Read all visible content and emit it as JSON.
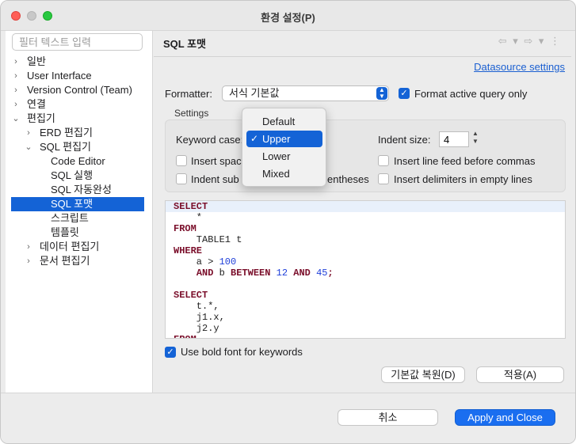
{
  "window": {
    "title": "환경 설정(P)"
  },
  "sidebar": {
    "filter_placeholder": "필터 텍스트 입력",
    "items": [
      {
        "label": "일반",
        "chevron": "›"
      },
      {
        "label": "User Interface",
        "chevron": "›"
      },
      {
        "label": "Version Control (Team)",
        "chevron": "›"
      },
      {
        "label": "연결",
        "chevron": "›"
      },
      {
        "label": "편집기",
        "chevron": "⌄"
      },
      {
        "label": "ERD 편집기",
        "chevron": "›"
      },
      {
        "label": "SQL 편집기",
        "chevron": "⌄"
      },
      {
        "label": "Code Editor",
        "chevron": ""
      },
      {
        "label": "SQL 실행",
        "chevron": ""
      },
      {
        "label": "SQL 자동완성",
        "chevron": ""
      },
      {
        "label": "SQL 포맷",
        "chevron": "",
        "selected": true
      },
      {
        "label": "스크립트",
        "chevron": ""
      },
      {
        "label": "템플릿",
        "chevron": ""
      },
      {
        "label": "데이터 편집기",
        "chevron": "›"
      },
      {
        "label": "문서 편집기",
        "chevron": "›"
      }
    ]
  },
  "main": {
    "title": "SQL 포맷",
    "nav_arrows": "⇦ ▾  ⇨ ▾   ⋮",
    "datasource_link": "Datasource settings",
    "formatter_label": "Formatter:",
    "formatter_value": "서식 기본값",
    "format_active_query_label": "Format active query only",
    "format_active_query_checked": true,
    "settings_legend": "Settings",
    "keyword_case_label": "Keyword case:",
    "indent_size_label": "Indent size:",
    "indent_size_value": "4",
    "insert_spaces_label": "Insert spac",
    "indent_sub_label": "Indent sub",
    "parentheses_tail": "entheses",
    "insert_line_feed_label": "Insert line feed before commas",
    "insert_delimiters_label": "Insert delimiters in empty lines",
    "bold_keywords_label": "Use bold font for keywords",
    "bold_keywords_checked": true,
    "restore_defaults_label": "기본값 복원(D)",
    "apply_label": "적용(A)"
  },
  "keyword_case_dropdown": {
    "options": [
      "Default",
      "Upper",
      "Lower",
      "Mixed"
    ],
    "selected": "Upper",
    "check_glyph": "✓"
  },
  "code_preview": {
    "lines": [
      [
        {
          "t": "SELECT",
          "c": "kw"
        }
      ],
      [
        {
          "t": "    *",
          "c": "sym"
        }
      ],
      [
        {
          "t": "FROM",
          "c": "kw"
        }
      ],
      [
        {
          "t": "    TABLE1 t",
          "c": "sym"
        }
      ],
      [
        {
          "t": "WHERE",
          "c": "kw"
        }
      ],
      [
        {
          "t": "    a > ",
          "c": "sym"
        },
        {
          "t": "100",
          "c": "num"
        }
      ],
      [
        {
          "t": "    ",
          "c": "sym"
        },
        {
          "t": "AND",
          "c": "kw"
        },
        {
          "t": " b ",
          "c": "sym"
        },
        {
          "t": "BETWEEN",
          "c": "kw"
        },
        {
          "t": " ",
          "c": "sym"
        },
        {
          "t": "12",
          "c": "num"
        },
        {
          "t": " ",
          "c": "sym"
        },
        {
          "t": "AND",
          "c": "kw"
        },
        {
          "t": " ",
          "c": "sym"
        },
        {
          "t": "45",
          "c": "num"
        },
        {
          "t": ";",
          "c": "kw"
        }
      ],
      [
        {
          "t": "",
          "c": "sym"
        }
      ],
      [
        {
          "t": "SELECT",
          "c": "kw"
        }
      ],
      [
        {
          "t": "    t.*,",
          "c": "sym"
        }
      ],
      [
        {
          "t": "    j1.x,",
          "c": "sym"
        }
      ],
      [
        {
          "t": "    j2.y",
          "c": "sym"
        }
      ],
      [
        {
          "t": "FROM",
          "c": "kw"
        }
      ]
    ]
  },
  "footer": {
    "cancel_label": "취소",
    "apply_close_label": "Apply and Close"
  },
  "colors": {
    "accent": "#1463d6",
    "keyword": "#7a0e2a",
    "number": "#1f3fd9",
    "link": "#1a5fd1"
  }
}
